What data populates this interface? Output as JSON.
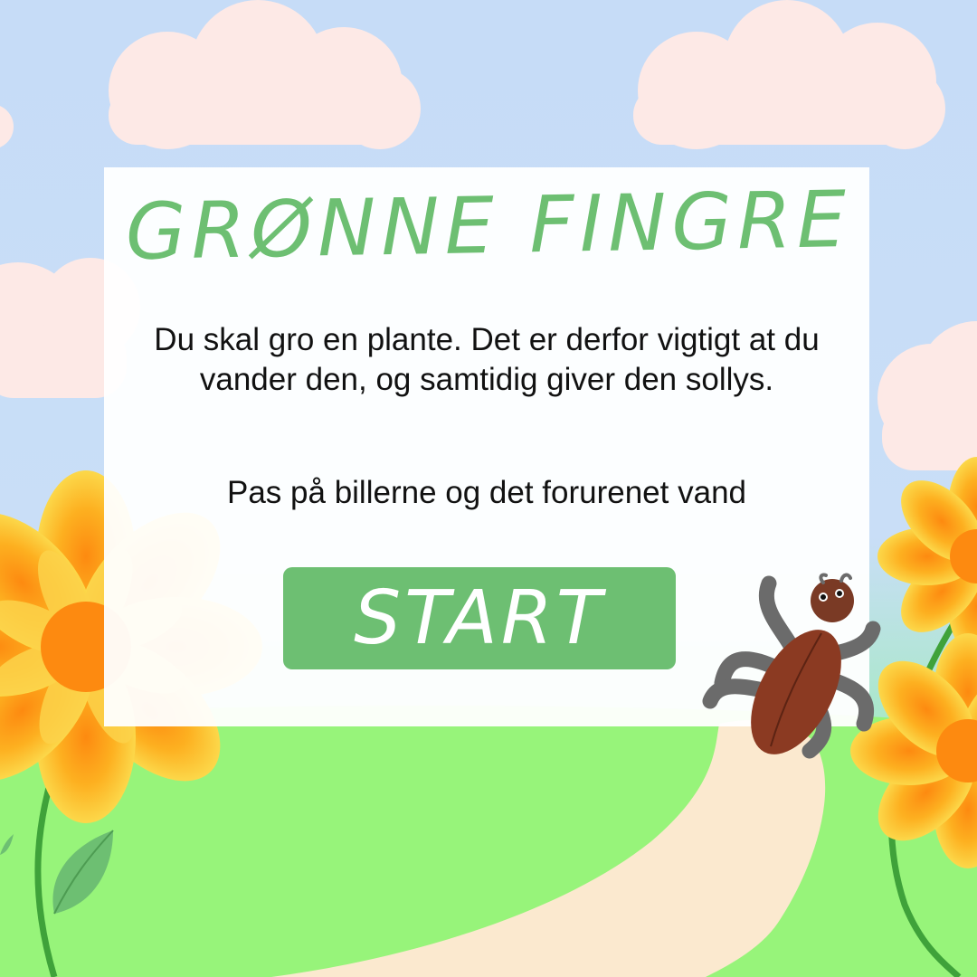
{
  "game": {
    "title": "GRØNNE FINGRE",
    "instructions": "Du skal gro en plante. Det er derfor vigtigt at du vander den, og samtidig giver den sollys.",
    "warning": "Pas på billerne og det forurenet vand",
    "start_label": "START"
  },
  "colors": {
    "sky": "#c9def7",
    "grass": "#97f47a",
    "path": "#fbe9cf",
    "accent_green": "#6dbf72",
    "cloud": "#fde9e6",
    "flower_orange": "#fda11a",
    "flower_yellow": "#fcd34a",
    "beetle_brown": "#8b3a22",
    "beetle_legs": "#6b6b6b"
  },
  "icons": {
    "cloud": "cloud-icon",
    "flower": "flower-icon",
    "leaf": "leaf-icon",
    "beetle": "beetle-icon"
  }
}
